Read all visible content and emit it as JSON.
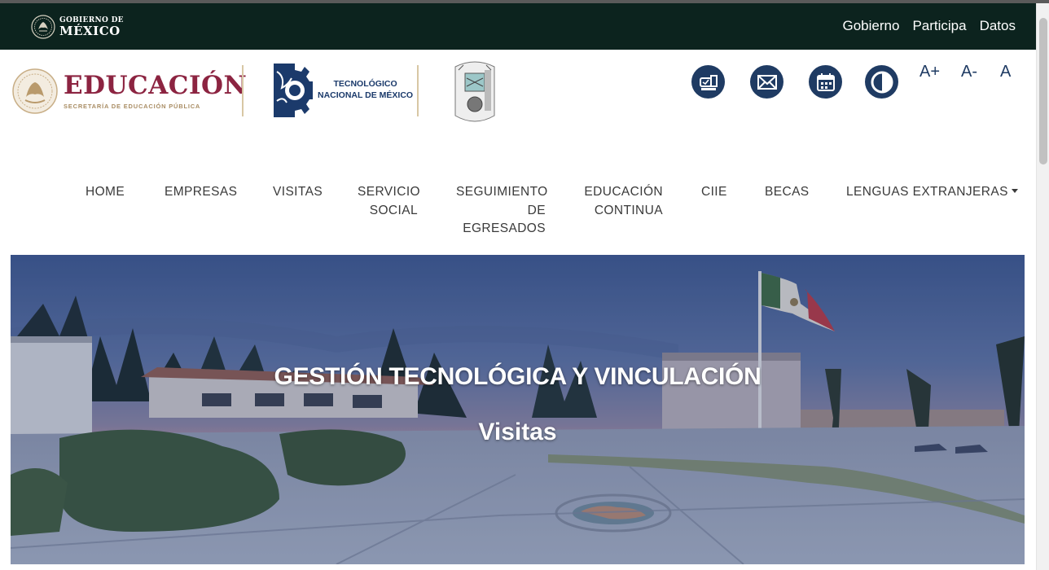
{
  "gov_bar": {
    "logo_line1": "GOBIERNO DE",
    "logo_line2": "MÉXICO",
    "links": [
      "Gobierno",
      "Participa",
      "Datos"
    ]
  },
  "header": {
    "sep_logo": {
      "title": "EDUCACIÓN",
      "subtitle": "SECRETARÍA DE EDUCACIÓN PÚBLICA"
    },
    "tecnm_logo": {
      "line1": "TECNOLÓGICO",
      "line2": "NACIONAL DE MÉXICO"
    },
    "tools": {
      "icons": [
        "mailbox-icon",
        "envelope-icon",
        "calendar-icon",
        "contrast-icon"
      ],
      "font_increase": "A+",
      "font_decrease": "A-",
      "font_reset": "A"
    }
  },
  "nav": {
    "items": [
      {
        "label": "HOME"
      },
      {
        "label": "EMPRESAS"
      },
      {
        "label": "VISITAS"
      },
      {
        "label_lines": [
          "SERVICIO",
          "SOCIAL"
        ]
      },
      {
        "label_lines": [
          "SEGUIMIENTO",
          "DE",
          "EGRESADOS"
        ]
      },
      {
        "label_lines": [
          "EDUCACIÓN",
          "CONTINUA"
        ]
      },
      {
        "label": "CIIE"
      },
      {
        "label": "BECAS"
      },
      {
        "label": "LENGUAS EXTRANJERAS"
      }
    ]
  },
  "hero": {
    "title": "GESTIÓN TECNOLÓGICA Y VINCULACIÓN",
    "subtitle": "Visitas"
  },
  "colors": {
    "gov_bar": "#0c231e",
    "sep_red": "#8c2441",
    "gold": "#a98d64",
    "tecnm_blue": "#1b3a6b",
    "icon_blue": "#1f3b63"
  }
}
